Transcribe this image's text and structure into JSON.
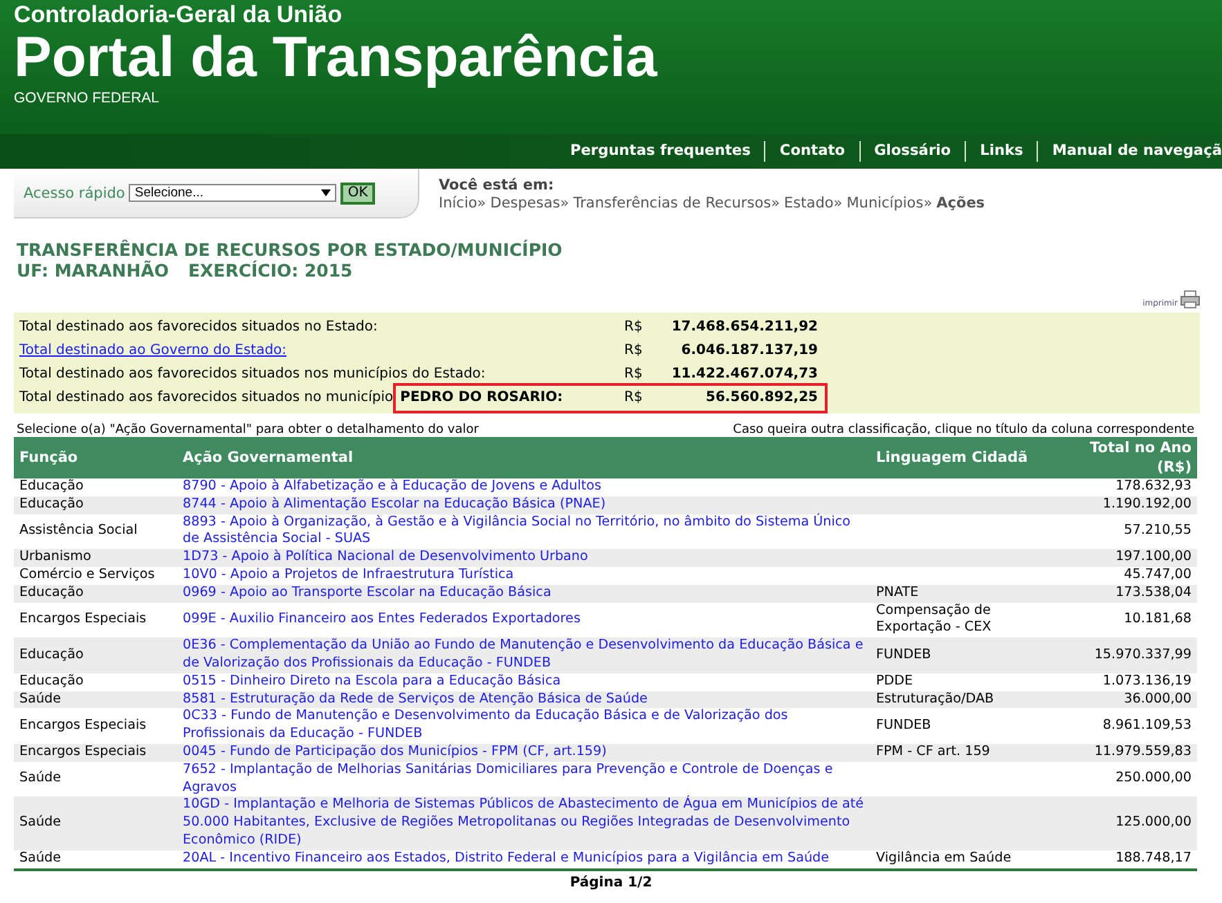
{
  "header": {
    "org": "Controladoria-Geral da União",
    "title": "Portal da Transparência",
    "subtitle": "GOVERNO FEDERAL"
  },
  "nav": [
    "Perguntas frequentes",
    "Contato",
    "Glossário",
    "Links",
    "Manual de navegaçã"
  ],
  "quick_access": {
    "label": "Acesso rápido",
    "select": "Selecione...",
    "button": "OK"
  },
  "breadcrumb": {
    "heading": "Você está em:",
    "separator": "»",
    "items": [
      {
        "label": "Início",
        "current": false
      },
      {
        "label": "Despesas",
        "current": false
      },
      {
        "label": "Transferências de Recursos",
        "current": false
      },
      {
        "label": "Estado",
        "current": false
      },
      {
        "label": "Municípios",
        "current": false
      },
      {
        "label": "Ações",
        "current": true
      }
    ]
  },
  "page_title": {
    "title": "TRANSFERÊNCIA DE RECURSOS POR ESTADO/MUNICÍPIO",
    "uf": "UF: MARANHÃO",
    "year": "EXERCÍCIO: 2015"
  },
  "print_label": "imprimir",
  "summary": [
    {
      "kind": "text",
      "label": "Total destinado aos favorecidos situados no Estado:",
      "currency": "R$",
      "amount": "17.468.654.211,92",
      "highlighted": false
    },
    {
      "kind": "link",
      "label": "Total destinado ao Governo do Estado:",
      "currency": "R$",
      "amount": "6.046.187.137,19",
      "highlighted": false
    },
    {
      "kind": "text",
      "label": "Total destinado aos favorecidos situados nos municípios do Estado:",
      "currency": "R$",
      "amount": "11.422.467.074,73",
      "highlighted": false
    },
    {
      "kind": "text",
      "label": "Total destinado aos favorecidos situados no município",
      "place": "PEDRO DO ROSARIO:",
      "currency": "R$",
      "amount": "56.560.892,25",
      "highlighted": true
    }
  ],
  "table": {
    "hint_left": "Selecione o(a) \"Ação Governamental\" para obter o detalhamento do valor",
    "hint_right": "Caso queira outra classificação, clique no título da coluna correspondente",
    "columns": [
      "Função",
      "Ação Governamental",
      "Linguagem Cidadã",
      "Total no Ano (R$)"
    ],
    "rows": [
      {
        "function": "Educação",
        "action": "8790 - Apoio à Alfabetização e à Educação de Jovens e Adultos",
        "citizen": "",
        "total": "178.632,93"
      },
      {
        "function": "Educação",
        "action": "8744 - Apoio à Alimentação Escolar na Educação Básica (PNAE)",
        "citizen": "",
        "total": "1.190.192,00"
      },
      {
        "function": "Assistência Social",
        "action": "8893 - Apoio à Organização, à Gestão e à Vigilância Social no Território, no âmbito do Sistema Único de Assistência Social - SUAS",
        "citizen": "",
        "total": "57.210,55"
      },
      {
        "function": "Urbanismo",
        "action": "1D73 - Apoio à Política Nacional de Desenvolvimento Urbano",
        "citizen": "",
        "total": "197.100,00"
      },
      {
        "function": "Comércio e Serviços",
        "action": "10V0 - Apoio a Projetos de Infraestrutura Turística",
        "citizen": "",
        "total": "45.747,00"
      },
      {
        "function": "Educação",
        "action": "0969 - Apoio ao Transporte Escolar na Educação Básica",
        "citizen": "PNATE",
        "total": "173.538,04"
      },
      {
        "function": "Encargos Especiais",
        "action": "099E - Auxilio Financeiro aos Entes Federados Exportadores",
        "citizen": "Compensação de Exportação - CEX",
        "total": "10.181,68"
      },
      {
        "function": "Educação",
        "action": "0E36 - Complementação da União ao Fundo de Manutenção e Desenvolvimento da Educação Básica e de Valorização dos Profissionais da Educação - FUNDEB",
        "citizen": "FUNDEB",
        "total": "15.970.337,99"
      },
      {
        "function": "Educação",
        "action": "0515 - Dinheiro Direto na Escola para a Educação Básica",
        "citizen": "PDDE",
        "total": "1.073.136,19"
      },
      {
        "function": "Saúde",
        "action": "8581 - Estruturação da Rede de Serviços de Atenção Básica de Saúde",
        "citizen": "Estruturação/DAB",
        "total": "36.000,00"
      },
      {
        "function": "Encargos Especiais",
        "action": "0C33 - Fundo de Manutenção e Desenvolvimento da Educação Básica e de Valorização dos Profissionais da Educação - FUNDEB",
        "citizen": "FUNDEB",
        "total": "8.961.109,53"
      },
      {
        "function": "Encargos Especiais",
        "action": "0045 - Fundo de Participação dos Municípios - FPM (CF, art.159)",
        "citizen": "FPM - CF art. 159",
        "total": "11.979.559,83"
      },
      {
        "function": "Saúde",
        "action": "7652 - Implantação de Melhorias Sanitárias Domiciliares para Prevenção e Controle de Doenças e Agravos",
        "citizen": "",
        "total": "250.000,00"
      },
      {
        "function": "Saúde",
        "action": "10GD - Implantação e Melhoria de Sistemas Públicos de Abastecimento de Água em Municípios de até 50.000 Habitantes, Exclusive de Regiões Metropolitanas ou Regiões Integradas de Desenvolvimento Econômico (RIDE)",
        "citizen": "",
        "total": "125.000,00"
      },
      {
        "function": "Saúde",
        "action": "20AL - Incentivo Financeiro aos Estados, Distrito Federal e Municípios para a Vigilância em Saúde",
        "citizen": "Vigilância em Saúde",
        "total": "188.748,17"
      }
    ]
  },
  "pagination": "Página 1/2"
}
